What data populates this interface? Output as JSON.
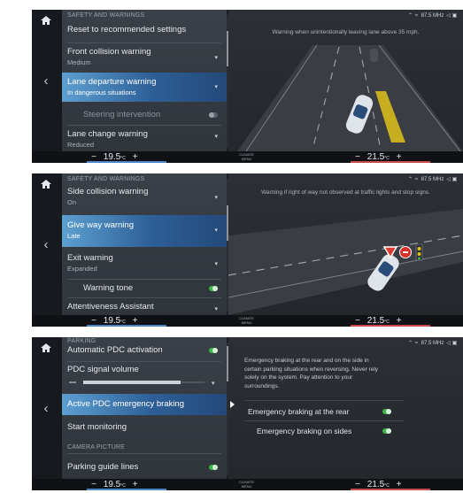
{
  "status_bar": {
    "radio": "87.5 MHz"
  },
  "climate": {
    "button_label_1": "CLIMATE",
    "button_label_2": "MENU",
    "temp_left": "19.5",
    "temp_right": "21.5",
    "unit": "°C",
    "minus": "−",
    "plus": "+"
  },
  "panel1": {
    "section_header": "SAFETY AND WARNINGS",
    "items": [
      {
        "label": "Reset to recommended settings",
        "sub": ""
      },
      {
        "label": "Front collision warning",
        "sub": "Medium"
      },
      {
        "label": "Lane departure warning",
        "sub": "In dangerous situations"
      },
      {
        "label": "Steering intervention",
        "sub": ""
      },
      {
        "label": "Lane change warning",
        "sub": "Reduced"
      }
    ],
    "caption": "Warning when unintentionally leaving lane above 35 mph."
  },
  "panel2": {
    "section_header": "SAFETY AND WARNINGS",
    "items": [
      {
        "label": "Side collision warning",
        "sub": "On"
      },
      {
        "label": "Give way warning",
        "sub": "Late"
      },
      {
        "label": "Exit warning",
        "sub": "Expanded"
      },
      {
        "label": "Warning tone",
        "sub": ""
      },
      {
        "label": "Attentiveness Assistant",
        "sub": ""
      }
    ],
    "caption": "Warning if right of way not observed at traffic lights and stop signs."
  },
  "panel3": {
    "section_header": "PARKING",
    "items": [
      {
        "label": "Automatic PDC activation",
        "sub": ""
      },
      {
        "label": "PDC signal volume",
        "sub": ""
      },
      {
        "label": "Active PDC emergency braking",
        "sub": ""
      },
      {
        "label": "Start monitoring",
        "sub": ""
      },
      {
        "label": "Parking guide lines",
        "sub": ""
      }
    ],
    "subsection_header": "CAMERA PICTURE",
    "description": "Emergency braking at the rear and on the side in certain parking situations when reversing. Never rely solely on the system. Pay attention to your surroundings.",
    "options": [
      {
        "label": "Emergency braking at the rear",
        "state": "on"
      },
      {
        "label": "Emergency braking on sides",
        "state": "on"
      }
    ]
  },
  "colors": {
    "selected_highlight": "#3f7fbf",
    "toggle_on": "#3db54a",
    "lane_warning": "#e0c21a",
    "temp_left_line": "#4a86c8",
    "temp_right_line": "#c84a4a",
    "stop_sign": "#d9302a"
  },
  "icons": [
    "home-icon",
    "back-arrow-icon",
    "chevron-down-icon",
    "toggle-switch-icon",
    "signal-icon",
    "radio-icon",
    "volume-icon",
    "phone-icon",
    "chevron-right-icon",
    "yield-sign-icon",
    "stop-sign-icon",
    "traffic-light-icon"
  ]
}
